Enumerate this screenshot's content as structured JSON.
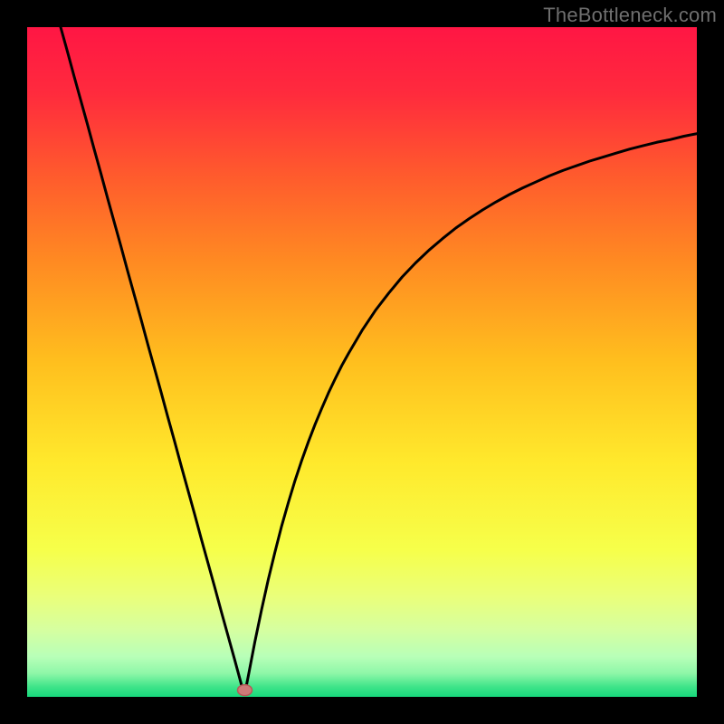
{
  "watermark": "TheBottleneck.com",
  "colors": {
    "frame": "#000000",
    "curve": "#000000",
    "marker_fill": "#cf7a78",
    "marker_stroke": "#b55a58",
    "gradient_stops": [
      {
        "offset": 0.0,
        "color": "#ff1644"
      },
      {
        "offset": 0.1,
        "color": "#ff2b3d"
      },
      {
        "offset": 0.22,
        "color": "#ff5a2d"
      },
      {
        "offset": 0.35,
        "color": "#ff8a22"
      },
      {
        "offset": 0.5,
        "color": "#ffbf1e"
      },
      {
        "offset": 0.65,
        "color": "#ffe92c"
      },
      {
        "offset": 0.78,
        "color": "#f6ff4a"
      },
      {
        "offset": 0.85,
        "color": "#eaff7a"
      },
      {
        "offset": 0.9,
        "color": "#d6ffa0"
      },
      {
        "offset": 0.94,
        "color": "#b8ffb8"
      },
      {
        "offset": 0.965,
        "color": "#8ef7a8"
      },
      {
        "offset": 0.985,
        "color": "#3fe489"
      },
      {
        "offset": 1.0,
        "color": "#17d97c"
      }
    ]
  },
  "chart_data": {
    "type": "line",
    "title": "",
    "xlabel": "",
    "ylabel": "",
    "xlim": [
      0,
      100
    ],
    "ylim": [
      0,
      100
    ],
    "grid": false,
    "legend": false,
    "marker": {
      "x": 32.5,
      "y": 1.0
    },
    "series": [
      {
        "name": "curve",
        "x": [
          5,
          6,
          7,
          8,
          9,
          10,
          11,
          12,
          13,
          14,
          15,
          16,
          17,
          18,
          19,
          20,
          21,
          22,
          23,
          24,
          25,
          26,
          27,
          28,
          29,
          30,
          31,
          32,
          32.5,
          33,
          34,
          35,
          36,
          37,
          38,
          39,
          40,
          41,
          42,
          43,
          44,
          45,
          46,
          47,
          48,
          50,
          52,
          54,
          56,
          58,
          60,
          62,
          64,
          66,
          68,
          70,
          72,
          74,
          76,
          78,
          80,
          82,
          84,
          86,
          88,
          90,
          92,
          94,
          96,
          98,
          100
        ],
        "y": [
          100,
          96.4,
          92.7,
          89.1,
          85.5,
          81.8,
          78.2,
          74.5,
          70.9,
          67.3,
          63.6,
          60.0,
          56.4,
          52.7,
          49.1,
          45.5,
          41.8,
          38.2,
          34.5,
          30.9,
          27.3,
          23.6,
          20.0,
          16.4,
          12.7,
          9.1,
          5.5,
          1.8,
          0.5,
          3.0,
          8.2,
          13.0,
          17.5,
          21.6,
          25.5,
          29.0,
          32.3,
          35.3,
          38.1,
          40.7,
          43.1,
          45.4,
          47.5,
          49.5,
          51.3,
          54.7,
          57.7,
          60.3,
          62.7,
          64.8,
          66.7,
          68.4,
          70.0,
          71.4,
          72.7,
          73.9,
          75.0,
          76.0,
          76.9,
          77.8,
          78.6,
          79.3,
          80.0,
          80.6,
          81.2,
          81.8,
          82.3,
          82.8,
          83.2,
          83.7,
          84.1
        ]
      }
    ]
  }
}
